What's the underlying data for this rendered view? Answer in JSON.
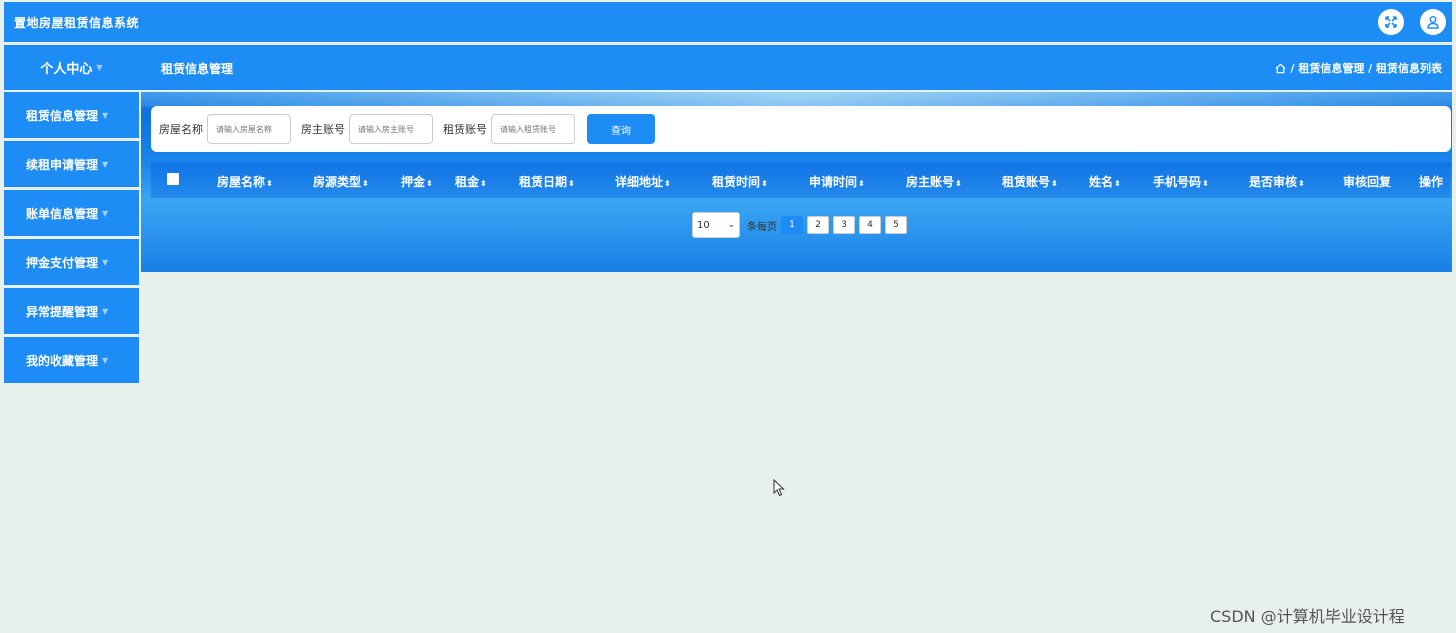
{
  "app": {
    "title": "置地房屋租赁信息系统"
  },
  "nav": {
    "personal_center": "个人中心",
    "section_title": "租赁信息管理",
    "breadcrumb": "/ 租赁信息管理 / 租赁信息列表"
  },
  "sidebar": {
    "items": [
      {
        "label": "租赁信息管理"
      },
      {
        "label": "续租申请管理"
      },
      {
        "label": "账单信息管理"
      },
      {
        "label": "押金支付管理"
      },
      {
        "label": "异常提醒管理"
      },
      {
        "label": "我的收藏管理"
      }
    ]
  },
  "search": {
    "house_name_label": "房屋名称",
    "house_name_placeholder": "请输入房屋名称",
    "owner_account_label": "房主账号",
    "owner_account_placeholder": "请输入房主账号",
    "renter_account_label": "租赁账号",
    "renter_account_placeholder": "请输入租赁账号",
    "query_button": "查询"
  },
  "table": {
    "columns": [
      "房屋名称",
      "房源类型",
      "押金",
      "租金",
      "租赁日期",
      "详细地址",
      "租赁时间",
      "申请时间",
      "房主账号",
      "租赁账号",
      "姓名",
      "手机号码",
      "是否审核",
      "审核回复",
      "操作"
    ]
  },
  "pager": {
    "page_size": "10",
    "per_page_label": "条每页",
    "pages": [
      "1",
      "2",
      "3",
      "4",
      "5"
    ]
  },
  "watermark": "CSDN @计算机毕业设计程",
  "colors": {
    "primary": "#1e8cf5",
    "background": "#e8f0ec"
  }
}
